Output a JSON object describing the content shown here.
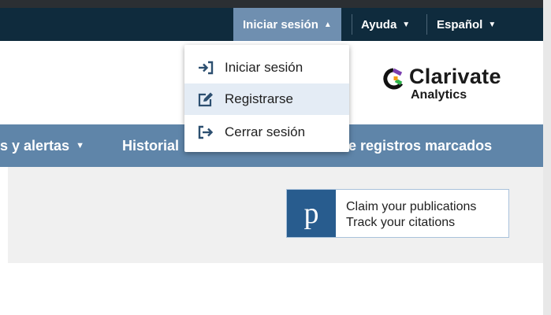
{
  "topbar": {
    "signin_label": "Iniciar sesión",
    "help_label": "Ayuda",
    "language_label": "Español"
  },
  "signin_menu": {
    "items": [
      {
        "label": "Iniciar sesión",
        "icon": "sign-in-icon"
      },
      {
        "label": "Registrarse",
        "icon": "edit-icon"
      },
      {
        "label": "Cerrar sesión",
        "icon": "sign-out-icon"
      }
    ],
    "hovered_index": 1
  },
  "logo": {
    "brand": "Clarivate",
    "sub": "Analytics"
  },
  "navbar": {
    "items": [
      {
        "label": "s y alertas",
        "has_caret": true
      },
      {
        "label": "Historial",
        "has_caret": false
      },
      {
        "label": "e registros marcados",
        "has_caret": false
      }
    ]
  },
  "publons": {
    "badge_letter": "p",
    "line1": "Claim your publications",
    "line2": "Track your citations"
  },
  "colors": {
    "topbar": "#0f2b3d",
    "signin_active": "#6f8fb0",
    "navbar": "#5f85a9",
    "publons_badge": "#285c8e",
    "dropdown_hover": "#e4ecf5"
  }
}
